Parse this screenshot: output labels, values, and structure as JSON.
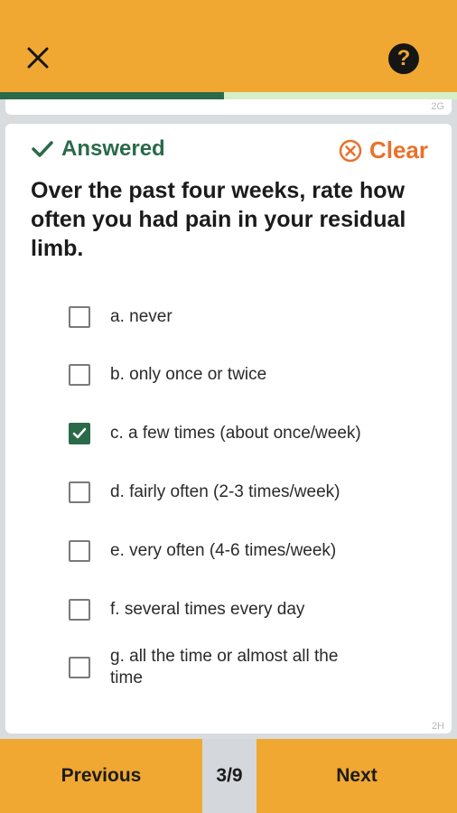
{
  "header": {
    "close_icon": "close-icon",
    "help_icon": "question-icon",
    "help_glyph": "?",
    "progress_fraction": 0.49
  },
  "prev_card": {
    "tag": "2G"
  },
  "card": {
    "status": {
      "label": "Answered",
      "icon": "check-icon",
      "color": "#2a6a49"
    },
    "clear": {
      "label": "Clear",
      "icon": "x-circle-icon",
      "color": "#e8722c"
    },
    "question": "Over the past four weeks, rate how often you had pain in your residual limb.",
    "options": [
      {
        "label": "a. never",
        "checked": false
      },
      {
        "label": "b. only once or twice",
        "checked": false
      },
      {
        "label": "c. a few times (about once/week)",
        "checked": true
      },
      {
        "label": "d. fairly often (2-3 times/week)",
        "checked": false
      },
      {
        "label": "e. very often (4-6 times/week)",
        "checked": false
      },
      {
        "label": "f. several times every day",
        "checked": false
      },
      {
        "label": "g. all the time or almost all the time",
        "checked": false
      }
    ],
    "tag": "2H"
  },
  "footer": {
    "previous_label": "Previous",
    "counter": "3/9",
    "next_label": "Next"
  },
  "colors": {
    "accent": "#f0a832",
    "primary_green": "#2a6a49",
    "clear_orange": "#e8722c"
  }
}
